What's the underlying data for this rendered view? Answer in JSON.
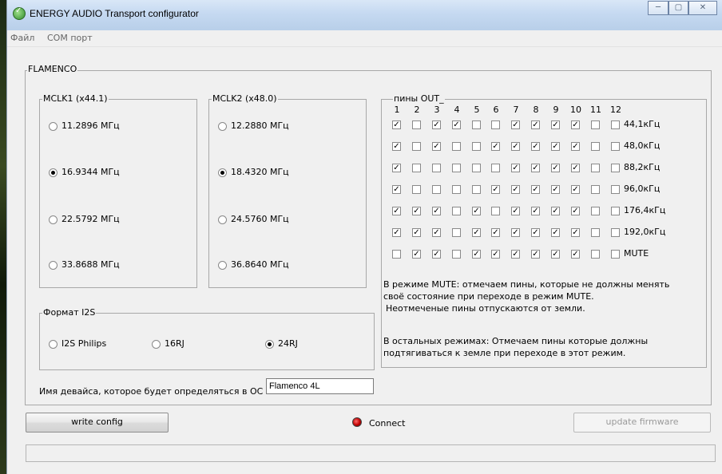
{
  "window": {
    "title": "ENERGY AUDIO Transport configurator",
    "controls": [
      "─",
      "▢",
      "✕"
    ]
  },
  "menu": [
    "Файл",
    "COM порт"
  ],
  "device_group": {
    "label": "FLAMENCO"
  },
  "mclk1": {
    "label": "MCLK1 (x44.1)",
    "options": [
      "11.2896 МГц",
      "16.9344 МГц",
      "22.5792 МГц",
      "33.8688 МГц"
    ],
    "selected_index": 1
  },
  "mclk2": {
    "label": "MCLK2 (x48.0)",
    "options": [
      "12.2880 МГц",
      "18.4320 МГц",
      "24.5760 МГц",
      "36.8640 МГц"
    ],
    "selected_index": 1
  },
  "i2s": {
    "label": "Формат I2S",
    "options": [
      "I2S Philips",
      "16RJ",
      "24RJ"
    ],
    "selected_index": 2
  },
  "pins": {
    "label": "пины  OUT_",
    "columns": [
      "1",
      "2",
      "3",
      "4",
      "5",
      "6",
      "7",
      "8",
      "9",
      "10",
      "11",
      "12"
    ],
    "rows": [
      {
        "label": "44,1кГц",
        "checks": [
          1,
          0,
          1,
          1,
          0,
          0,
          1,
          1,
          1,
          1,
          0,
          0
        ]
      },
      {
        "label": "48,0кГц",
        "checks": [
          1,
          0,
          1,
          0,
          0,
          1,
          1,
          1,
          1,
          1,
          0,
          0
        ]
      },
      {
        "label": "88,2кГц",
        "checks": [
          1,
          0,
          0,
          0,
          0,
          0,
          1,
          1,
          1,
          1,
          0,
          0
        ]
      },
      {
        "label": "96,0кГц",
        "checks": [
          1,
          0,
          0,
          0,
          0,
          1,
          1,
          1,
          1,
          1,
          0,
          0
        ]
      },
      {
        "label": "176,4кГц",
        "checks": [
          1,
          1,
          1,
          0,
          1,
          0,
          1,
          1,
          1,
          1,
          0,
          0
        ]
      },
      {
        "label": "192,0кГц",
        "checks": [
          1,
          1,
          1,
          0,
          1,
          1,
          1,
          1,
          1,
          1,
          0,
          0
        ]
      },
      {
        "label": "MUTE",
        "checks": [
          0,
          1,
          1,
          0,
          1,
          1,
          1,
          1,
          1,
          1,
          0,
          0
        ]
      }
    ],
    "note_mute": [
      "В режиме MUTE: отмечаем пины, которые не должны менять",
      "своё состояние при переходе в режим MUTE.",
      "Неотмеченые пины отпускаются от земли."
    ],
    "note_other": [
      "В остальных режимах: Отмечаем пины которые должны",
      "подтягиваться к земле при переходе в этот режим."
    ]
  },
  "device_name": {
    "label": "Имя девайса, которое будет определяться в ОС -",
    "value": "Flamenco 4L"
  },
  "actions": {
    "write_config": "write config",
    "connect": "Connect",
    "update_firmware": "update firmware"
  }
}
